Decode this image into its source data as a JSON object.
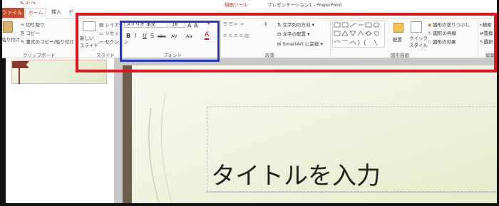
{
  "window": {
    "title": "プレゼンテーション1 - PowerPoint",
    "context_tab_group": "描画ツール"
  },
  "tabs": {
    "file": "ファイル",
    "home": "ホーム",
    "insert": "挿入",
    "design": "デ"
  },
  "clipboard": {
    "paste": "貼り付け",
    "cut": "切り取り",
    "copy": "コピー",
    "format_painter": "書式のコピー/貼り付け",
    "group_label": "クリップボード"
  },
  "slides": {
    "new_slide": "新しい\nスライド",
    "layout": "レイアウト",
    "reset": "リセット",
    "section": "セクション",
    "group_label": "スライド"
  },
  "font": {
    "name": "メイリオ 本文",
    "size": "18",
    "bold": "B",
    "italic": "I",
    "underline": "U",
    "shadow": "S",
    "strike": "abc",
    "spacing": "AV",
    "case": "Aa",
    "color": "A",
    "group_label": "フォント"
  },
  "paragraph": {
    "text_direction": "文字列の方向",
    "align_text": "文字の配置",
    "smartart": "SmartArt に変換",
    "group_label": "段落"
  },
  "drawing": {
    "arrange": "配置",
    "quick_styles": "クイック\nスタイル",
    "shape_fill": "図形の塗りつぶし",
    "shape_outline": "図形の枠線",
    "shape_effects": "図形の効果",
    "group_label": "図形描画"
  },
  "editing": {
    "find": "検索",
    "replace": "置換",
    "select": "選択",
    "group_label": "編集"
  },
  "slide": {
    "title_placeholder": "タイトルを入力"
  },
  "colors": {
    "accent": "#c74b2b",
    "red_highlight": "#e3121b",
    "blue_highlight": "#2d36c4"
  }
}
